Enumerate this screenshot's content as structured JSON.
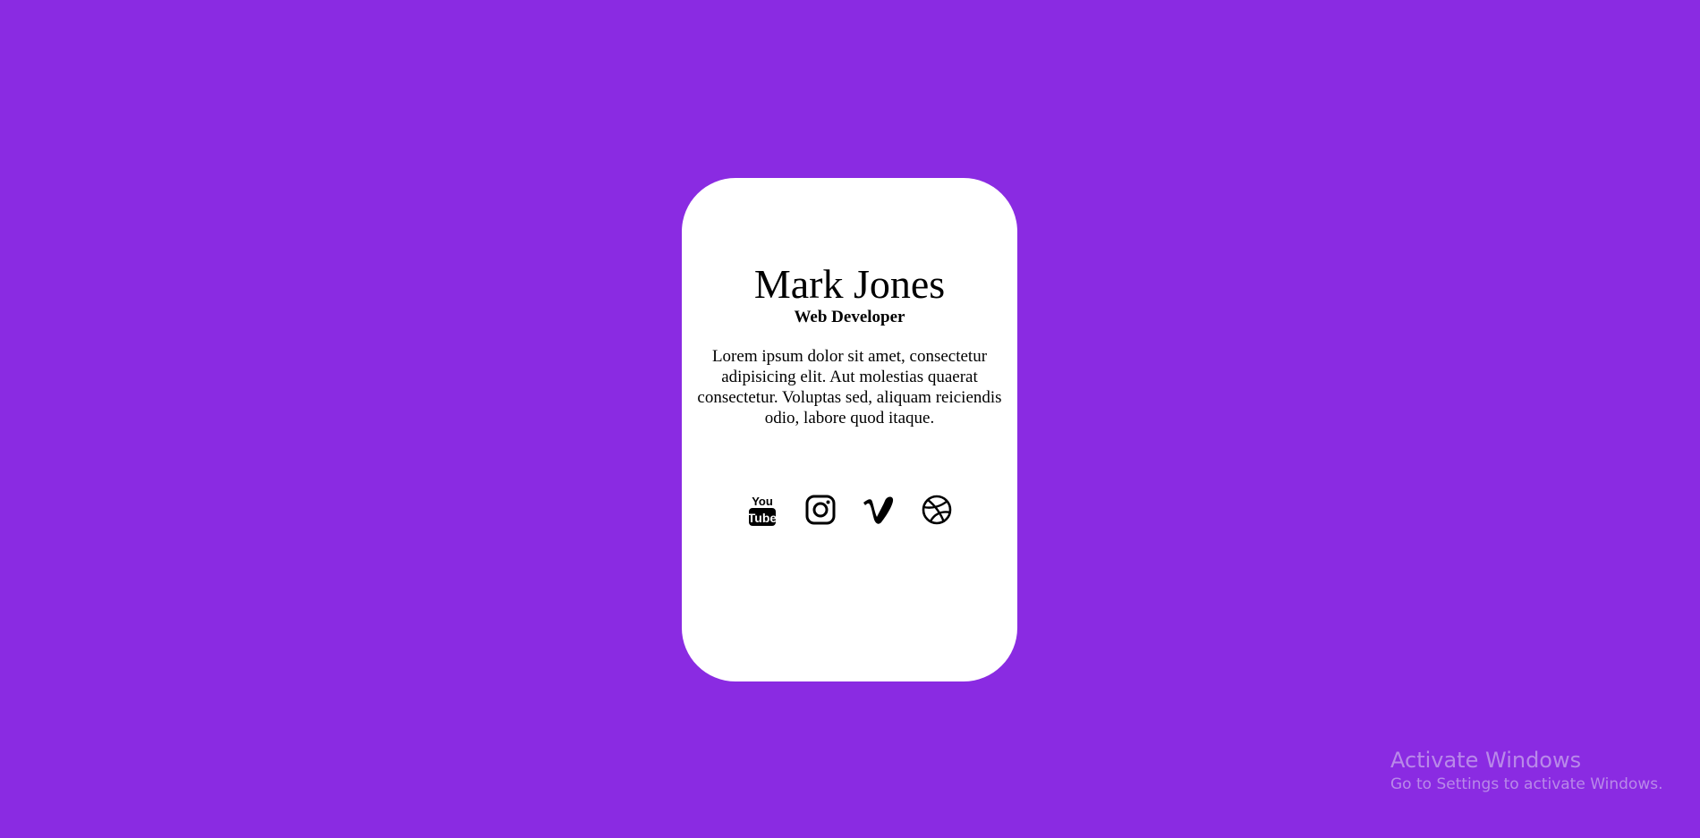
{
  "colors": {
    "background": "#8a2be2",
    "card": "#ffffff",
    "text": "#000000"
  },
  "profile": {
    "name": "Mark Jones",
    "role": "Web Developer",
    "bio": "Lorem ipsum dolor sit amet, consectetur adipisicing elit. Aut molestias quaerat consectetur. Voluptas sed, aliquam reiciendis odio, labore quod itaque."
  },
  "socials": [
    {
      "icon": "youtube-icon",
      "label": "YouTube"
    },
    {
      "icon": "instagram-icon",
      "label": "Instagram"
    },
    {
      "icon": "vimeo-icon",
      "label": "Vimeo"
    },
    {
      "icon": "dribbble-icon",
      "label": "Dribbble"
    }
  ],
  "watermark": {
    "title": "Activate Windows",
    "subtitle": "Go to Settings to activate Windows."
  }
}
